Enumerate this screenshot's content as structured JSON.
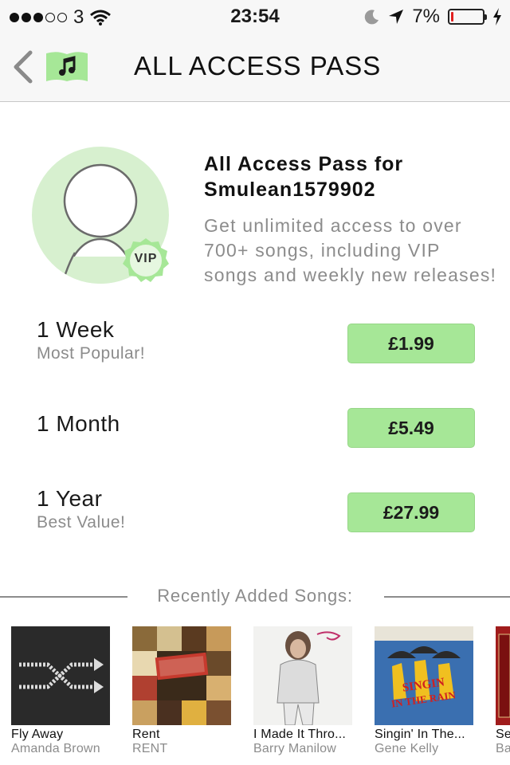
{
  "status_bar": {
    "carrier": "3",
    "time": "23:54",
    "battery_percent": "7%",
    "battery_level": 0.07,
    "icons": [
      "signal-dots-icon",
      "wifi-icon",
      "moon-icon",
      "location-arrow-icon",
      "battery-icon",
      "charging-bolt-icon"
    ]
  },
  "nav": {
    "title": "ALL ACCESS PASS",
    "back_icon": "chevron-left-icon",
    "songbook_icon": "songbook-music-note-icon"
  },
  "profile": {
    "vip_badge": "VIP",
    "title_line1": "All Access Pass for",
    "title_line2": "Smulean1579902",
    "description": "Get unlimited access to over 700+ songs, including VIP songs and weekly new releases!"
  },
  "plans": [
    {
      "name": "1 Week",
      "subtitle": "Most Popular!",
      "price": "£1.99"
    },
    {
      "name": "1 Month",
      "subtitle": "",
      "price": "£5.49"
    },
    {
      "name": "1 Year",
      "subtitle": "Best Value!",
      "price": "£27.99"
    }
  ],
  "recent": {
    "title": "Recently Added Songs:",
    "songs": [
      {
        "title": "Fly Away",
        "artist": "Amanda Brown"
      },
      {
        "title": "Rent",
        "artist": "RENT"
      },
      {
        "title": "I Made It Thro...",
        "artist": "Barry Manilow"
      },
      {
        "title": "Singin' In The...",
        "artist": "Gene Kelly"
      },
      {
        "title": "Se",
        "artist": "Ba"
      }
    ]
  },
  "colors": {
    "accent_green": "#a6e797",
    "avatar_bg": "#d7f0cf",
    "muted_text": "#8c8c8c",
    "battery_low": "#e02020"
  }
}
